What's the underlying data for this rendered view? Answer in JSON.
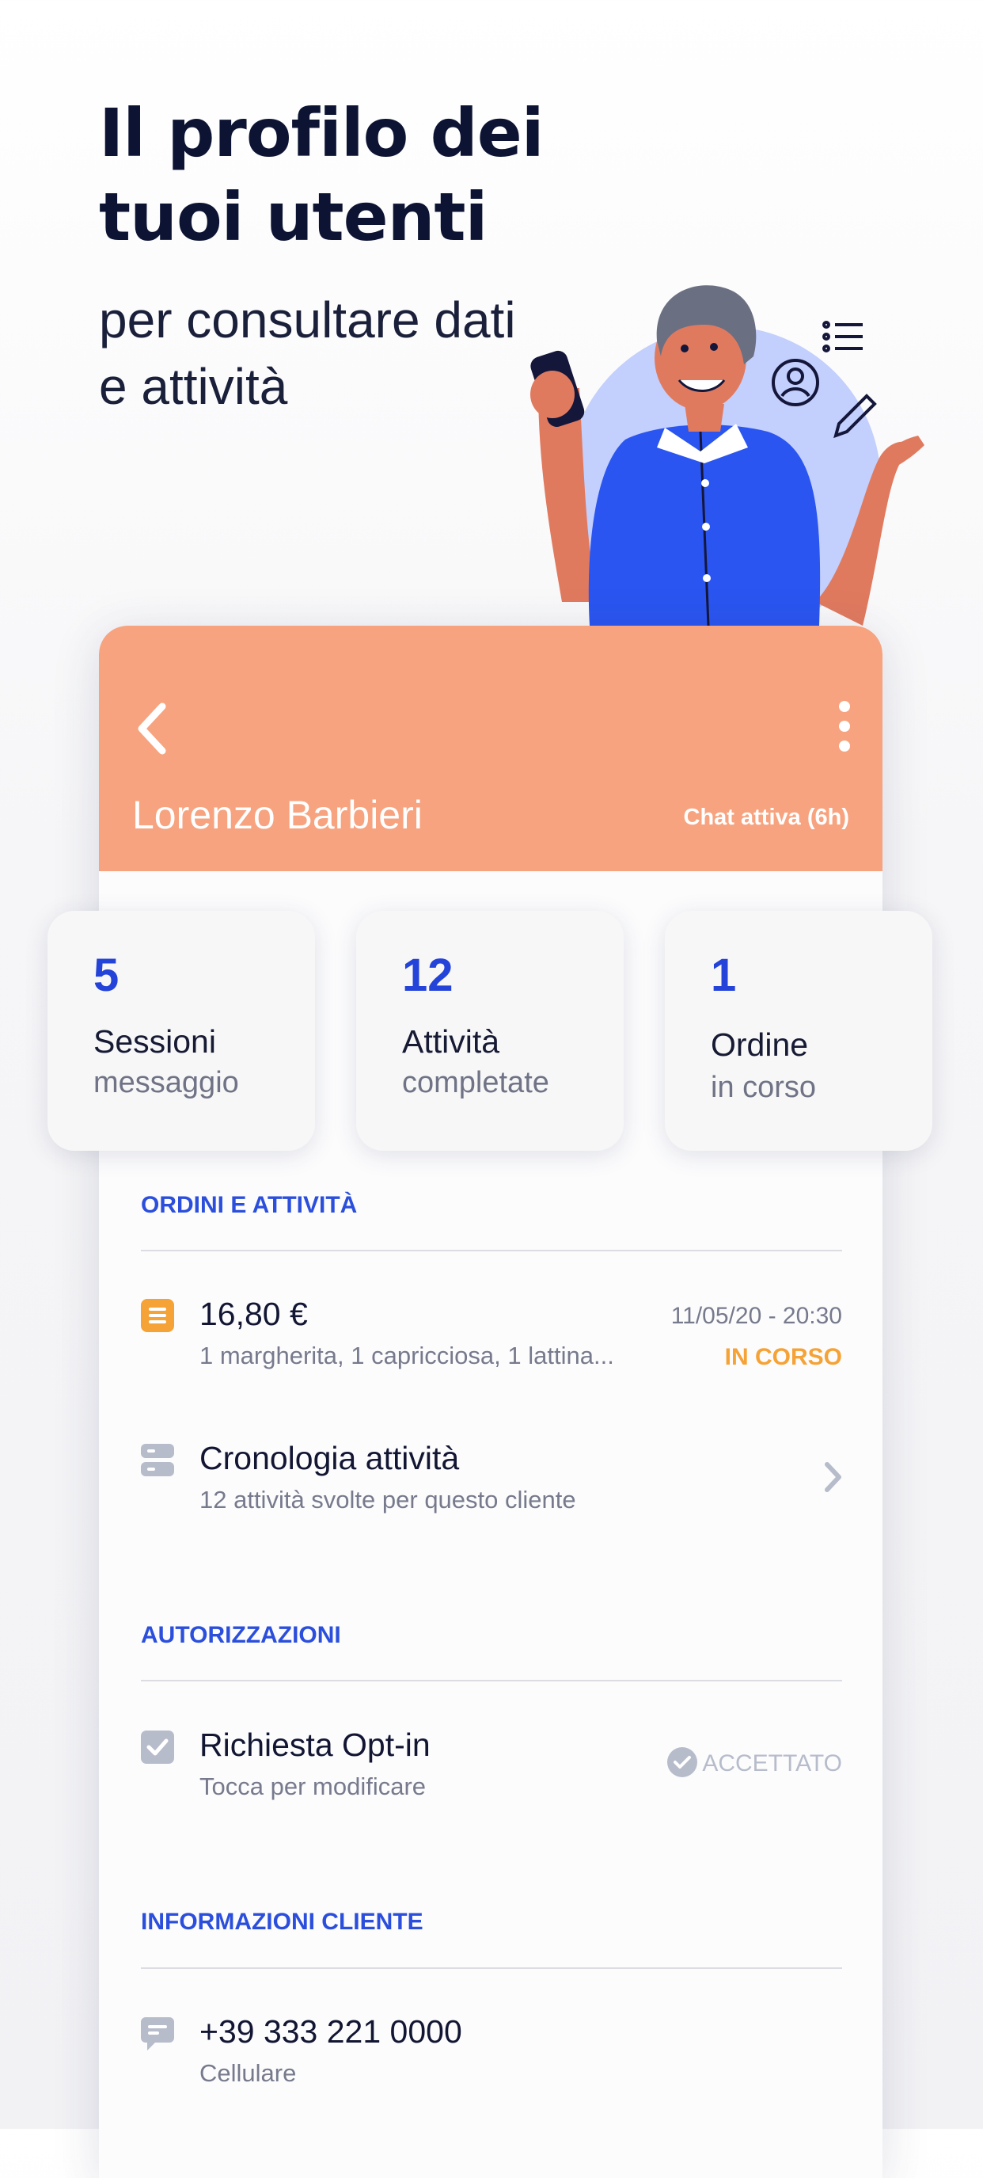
{
  "hero": {
    "title": "Il profilo dei tuoi utenti",
    "subtitle": "per consultare dati e attività"
  },
  "profile": {
    "name": "Lorenzo Barbieri",
    "chat_status": "Chat attiva (6h)",
    "header_color": "#f7a37f"
  },
  "stats": [
    {
      "value": "5",
      "label": "Sessioni",
      "sub": "messaggio"
    },
    {
      "value": "12",
      "label": "Attività",
      "sub": "completate"
    },
    {
      "value": "1",
      "label": "Ordine",
      "sub": "in corso"
    }
  ],
  "sections": {
    "orders_title": "ORDINI E ATTIVITÀ",
    "auth_title": "AUTORIZZAZIONI",
    "info_title": "INFORMAZIONI CLIENTE"
  },
  "order": {
    "amount": "16,80 €",
    "items": "1 margherita, 1 capricciosa, 1 lattina...",
    "datetime": "11/05/20 - 20:30",
    "status": "IN CORSO",
    "status_color": "#f5a236",
    "icon": "receipt-icon"
  },
  "history": {
    "title": "Cronologia attività",
    "sub": "12 attività svolte per questo cliente",
    "icon": "stack-icon"
  },
  "optin": {
    "title": "Richiesta Opt-in",
    "sub": "Tocca per modificare",
    "status": "ACCETTATO",
    "icon": "checkbox-icon"
  },
  "contact": {
    "phone": "+39 333 221 0000",
    "type": "Cellulare",
    "icon": "chat-bubble-icon"
  },
  "colors": {
    "accent": "#2443d8",
    "section_title": "#2b4fdc",
    "muted_icon": "#b7bccb"
  }
}
